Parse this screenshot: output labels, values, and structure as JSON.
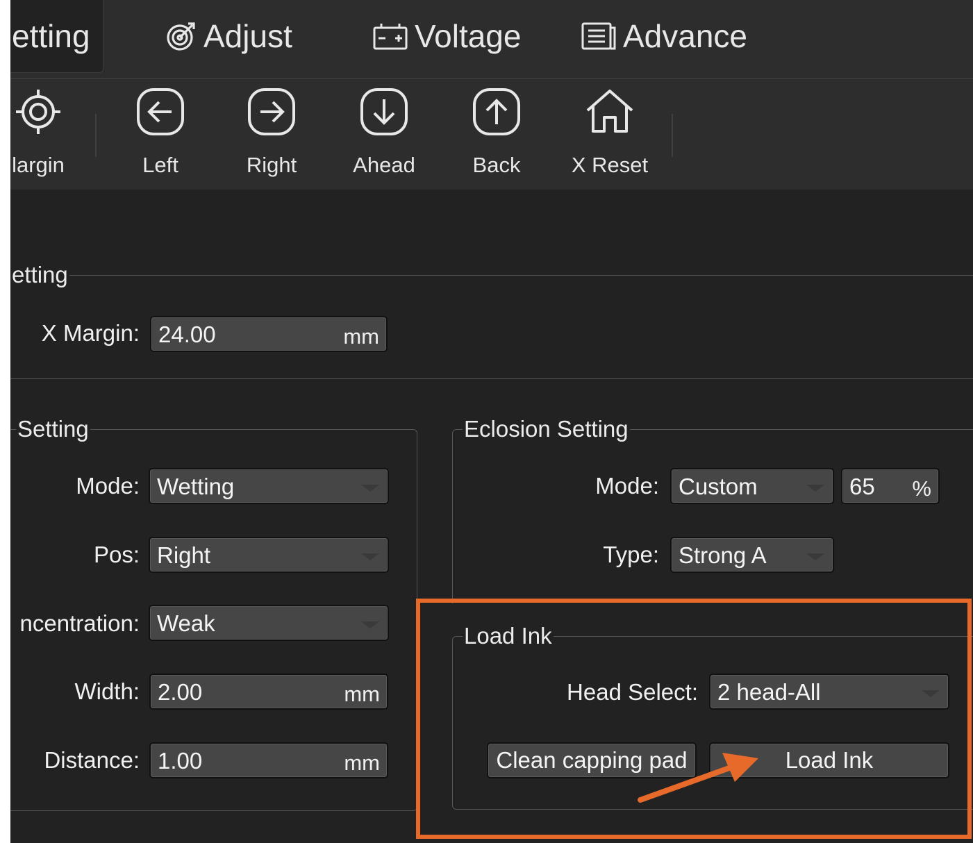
{
  "tabs": [
    {
      "label": "etting",
      "active": true
    },
    {
      "label": "Adjust",
      "icon": "target-icon"
    },
    {
      "label": "Voltage",
      "icon": "battery-icon"
    },
    {
      "label": "Advance",
      "icon": "list-icon"
    }
  ],
  "toolbar": {
    "margin_label": "largin",
    "left_label": "Left",
    "right_label": "Right",
    "ahead_label": "Ahead",
    "back_label": "Back",
    "xreset_label": "X Reset"
  },
  "margin_setting": {
    "title": "etting",
    "x_margin_label": "X Margin:",
    "x_margin_value": "24.00",
    "x_margin_unit": "mm"
  },
  "wet_setting": {
    "title": "Setting",
    "mode_label": "Mode:",
    "mode_value": "Wetting",
    "pos_label": "Pos:",
    "pos_value": "Right",
    "concentration_label": "ncentration:",
    "concentration_value": "Weak",
    "width_label": "Width:",
    "width_value": "2.00",
    "width_unit": "mm",
    "distance_label": "Distance:",
    "distance_value": "1.00",
    "distance_unit": "mm"
  },
  "eclosion_setting": {
    "title": "Eclosion Setting",
    "mode_label": "Mode:",
    "mode_value": "Custom",
    "percent_value": "65",
    "percent_unit": "%",
    "type_label": "Type:",
    "type_value": "Strong A"
  },
  "load_ink": {
    "title": "Load Ink",
    "head_select_label": "Head Select:",
    "head_select_value": "2 head-All",
    "clean_button": "Clean capping pad",
    "load_button": "Load Ink"
  },
  "colors": {
    "background": "#222222",
    "toolbar": "#2d2d2d",
    "field": "#464646",
    "highlight": "#e86a2a"
  }
}
